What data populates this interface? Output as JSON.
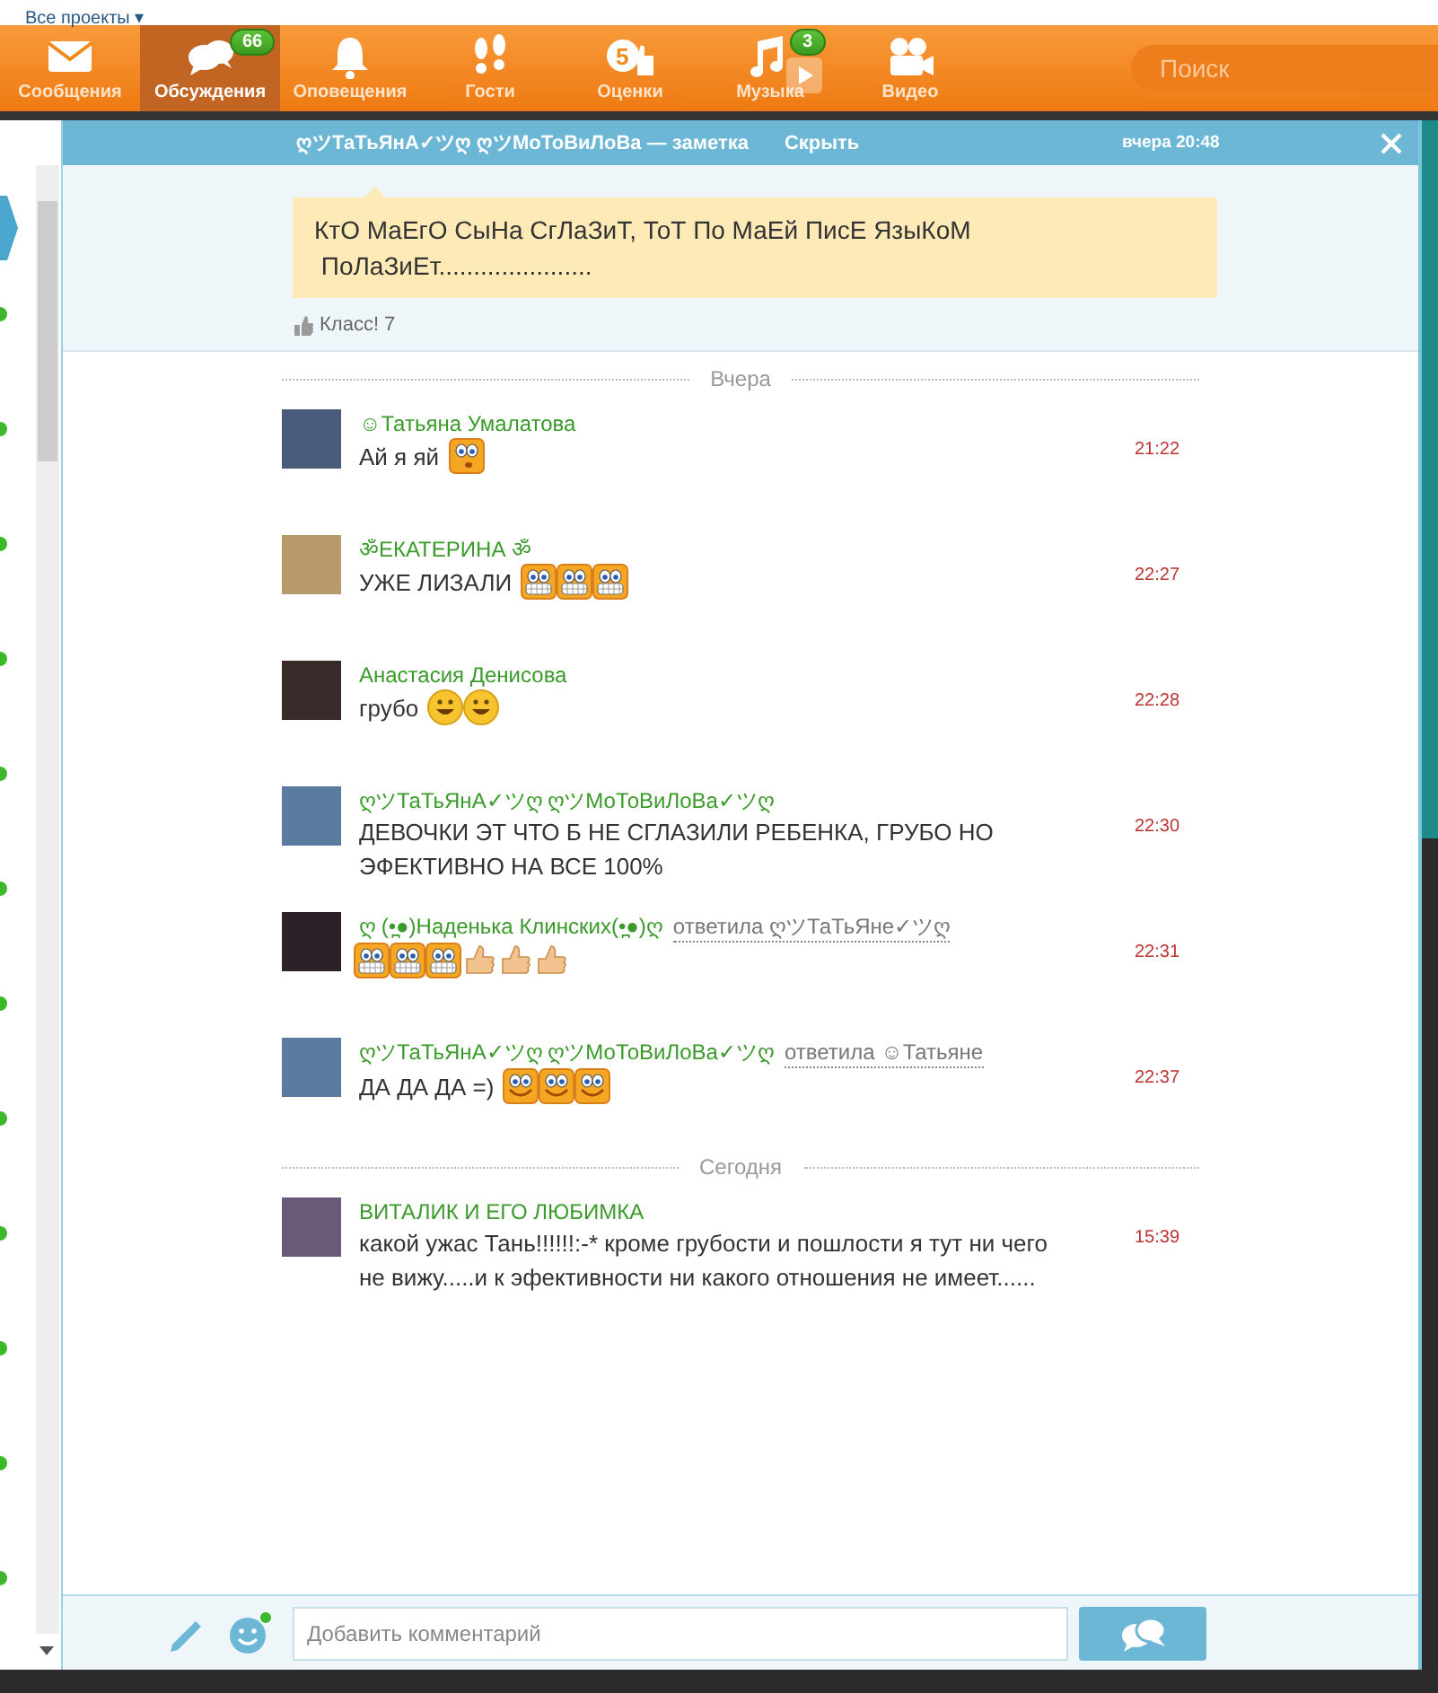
{
  "top_link": "Все проекты ▾",
  "nav": {
    "items": [
      {
        "label": "Сообщения",
        "selected": false
      },
      {
        "label": "Обсуждения",
        "badge": "66",
        "selected": true
      },
      {
        "label": "Оповещения",
        "selected": false
      },
      {
        "label": "Гости",
        "selected": false
      },
      {
        "label": "Оценки",
        "icon_text": "5",
        "selected": false
      },
      {
        "label": "Музыка",
        "badge": "3",
        "selected": false
      },
      {
        "label": "Видео",
        "selected": false
      }
    ],
    "search": {
      "placeholder": "Поиск"
    }
  },
  "note": {
    "title": "ღツТаТьЯнА✓ツღ ღツМоТоВиЛоВа — заметка",
    "hide_link": "Скрыть",
    "time": "вчера 20:48",
    "text": "КтО МаЕгО СыНа СгЛаЗиТ, ТоТ По МаЕй ПисЕ ЯзыКоМ\n ПоЛаЗиЕт......................",
    "likes": "Класс! 7"
  },
  "comments": [
    {
      "kind": "separator",
      "label": "Вчера"
    },
    {
      "kind": "comment",
      "author": "☺Татьяна Умалатова",
      "text": "Ай я яй",
      "emoticons": [
        {
          "kind": "surprised"
        }
      ],
      "time": "21:22"
    },
    {
      "kind": "comment",
      "author": "ॐЕКАТЕРИНА ॐ",
      "text": "УЖЕ ЛИЗАЛИ",
      "emoticons": [
        {
          "kind": "grin"
        },
        {
          "kind": "grin"
        },
        {
          "kind": "grin"
        }
      ],
      "time": "22:27"
    },
    {
      "kind": "comment",
      "author": "Анастасия Денисова",
      "text": "грубо",
      "emoticons": [
        {
          "kind": "smile"
        },
        {
          "kind": "smile"
        }
      ],
      "time": "22:28"
    },
    {
      "kind": "comment",
      "author": "ღツТаТьЯнА✓ツღ ღツМоТоВиЛоВа✓ツღ",
      "text": "ДЕВОЧКИ ЭТ ЧТО Б НЕ СГЛАЗИЛИ РЕБЕНКА, ГРУБО НО ЭФЕКТИВНО НА ВСЕ 100%",
      "time": "22:30"
    },
    {
      "kind": "comment",
      "author": "ღ (•̪●)Наденька Клинских(•̪●)ღ",
      "reply_to": "ответила ღツТаТьЯне✓ツღ",
      "emoticons": [
        {
          "kind": "grin"
        },
        {
          "kind": "grin"
        },
        {
          "kind": "grin"
        },
        {
          "kind": "thumbs"
        },
        {
          "kind": "thumbs"
        },
        {
          "kind": "thumbs"
        }
      ],
      "time": "22:31"
    },
    {
      "kind": "comment",
      "author": "ღツТаТьЯнА✓ツღ ღツМоТоВиЛоВа✓ツღ",
      "reply_to": "ответила ☺Татьяне",
      "text": "ДА ДА ДА =)",
      "emoticons": [
        {
          "kind": "happy"
        },
        {
          "kind": "happy"
        },
        {
          "kind": "happy"
        }
      ],
      "time": "22:37"
    },
    {
      "kind": "separator",
      "label": "Сегодня"
    },
    {
      "kind": "comment",
      "author": "ВИТАЛИК И ЕГО ЛЮБИМКА",
      "text": "какой ужас Тань!!!!!!:-* кроме грубости и пошлости я тут ни чего не вижу.....и к эфективности ни какого отношения не имеет......",
      "time": "15:39"
    }
  ],
  "composer": {
    "placeholder": "Добавить комментарий"
  }
}
